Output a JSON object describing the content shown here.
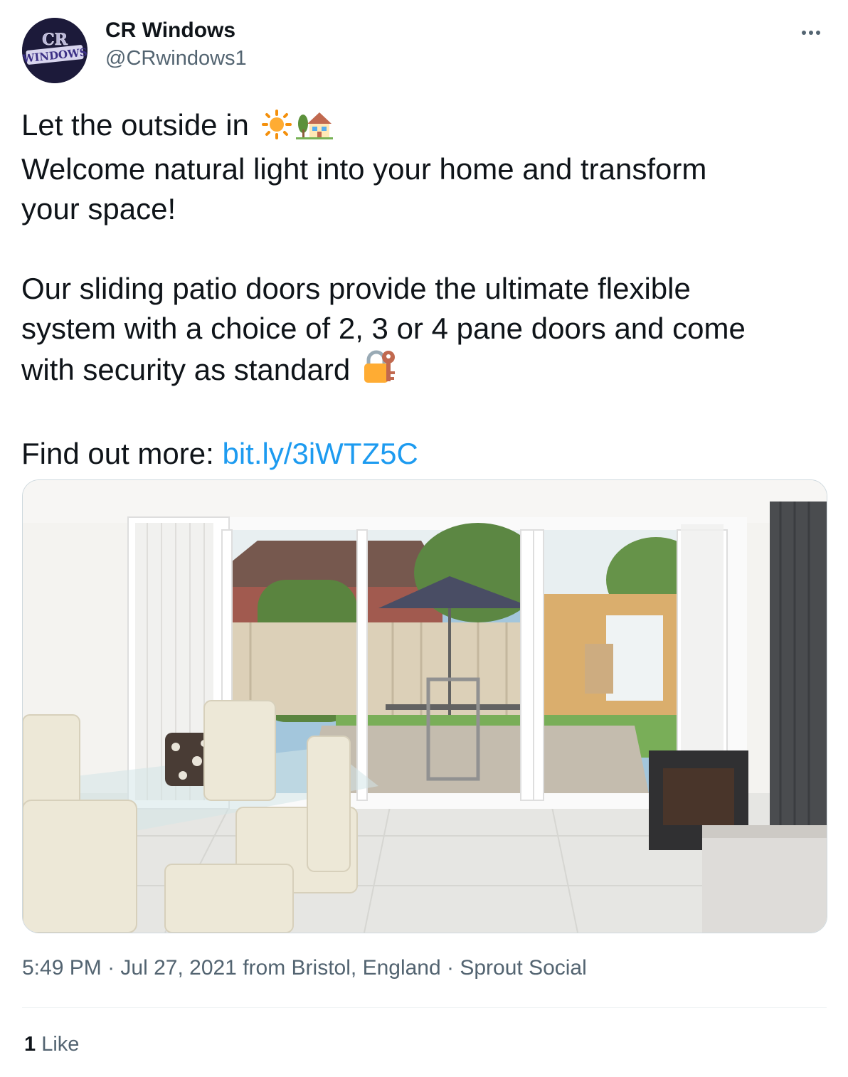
{
  "author": {
    "display_name": "CR Windows",
    "handle": "@CRwindows1",
    "avatar_text_top": "CR",
    "avatar_text_bottom": "WINDOWS"
  },
  "more_icon": "more-horizontal-icon",
  "tweet": {
    "line1": "Let the outside in",
    "line1_emojis": [
      "sun-emoji",
      "house-with-garden-emoji"
    ],
    "line2": "Welcome natural light into your home and transform",
    "line3": "your space!",
    "line4": "Our sliding patio doors provide the ultimate flexible",
    "line5": "system with a choice of 2, 3 or 4 pane doors and come",
    "line6": "with security as standard",
    "line6_emoji": "locked-with-key-emoji",
    "find_more": "Find out more:",
    "link": "bit.ly/3iWTZ5C"
  },
  "media": {
    "description_icon": "patio-doors-photo"
  },
  "meta": {
    "time": "5:49 PM",
    "sep1": " · ",
    "date": "Jul 27, 2021",
    "from": " from ",
    "location": "Bristol, England",
    "sep2": " · ",
    "source": "Sprout Social"
  },
  "stats": {
    "like_count": "1",
    "like_label": " Like"
  },
  "colors": {
    "link": "#1d9bf0",
    "secondary_text": "#536471",
    "primary_text": "#0f1419",
    "avatar_bg": "#1c1a3a"
  }
}
